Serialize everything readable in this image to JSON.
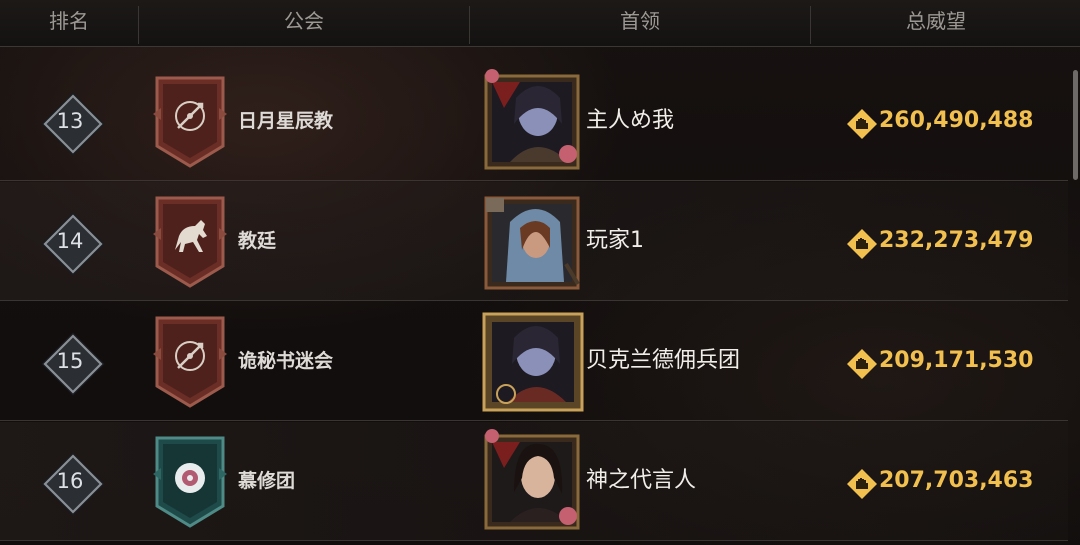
{
  "header": {
    "rank": "排名",
    "guild": "公会",
    "leader": "首领",
    "prestige": "总威望"
  },
  "rows": [
    {
      "rank": "13",
      "guild": "日月星辰教",
      "banner_icon": "compass-icon",
      "banner_color": "#6b2e26",
      "leader": "主人め我",
      "portrait": "blue-elf-portrait-icon",
      "prestige": "260,490,488"
    },
    {
      "rank": "14",
      "guild": "教廷",
      "banner_icon": "horse-icon",
      "banner_color": "#6b2e26",
      "leader": "玩家1",
      "portrait": "hooded-ranger-portrait-icon",
      "prestige": "232,273,479"
    },
    {
      "rank": "15",
      "guild": "诡秘书迷会",
      "banner_icon": "compass-icon",
      "banner_color": "#6b2e26",
      "leader": "贝克兰德佣兵团",
      "portrait": "blue-elf-portrait-icon",
      "prestige": "209,171,530"
    },
    {
      "rank": "16",
      "guild": "慕修团",
      "banner_icon": "flower-icon",
      "banner_color": "#1f4a4a",
      "leader": "神之代言人",
      "portrait": "dark-hair-woman-portrait-icon",
      "prestige": "207,703,463"
    }
  ],
  "colors": {
    "accent_gold": "#f2c04e",
    "rank_badge": "#8a8f96"
  }
}
